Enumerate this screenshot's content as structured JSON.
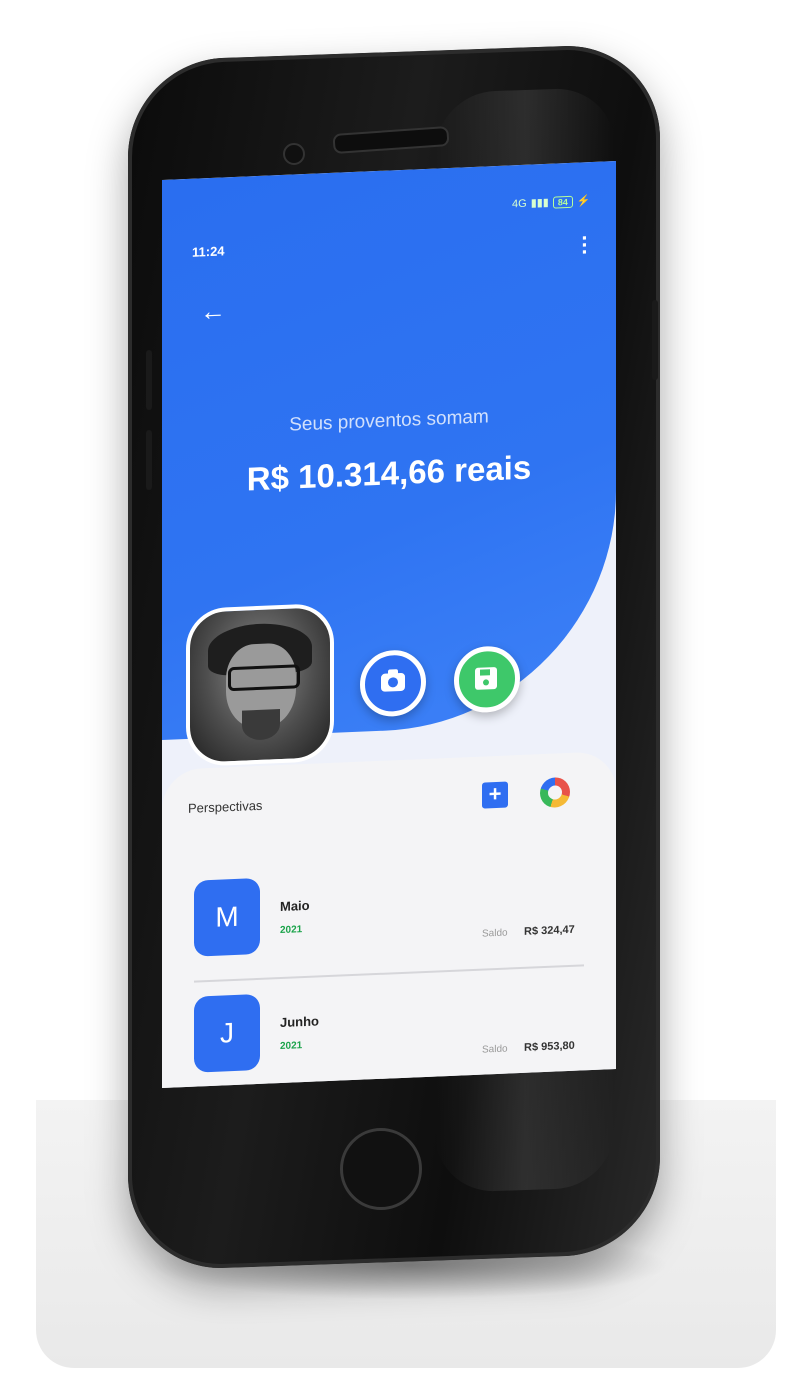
{
  "status_bar": {
    "time": "11:24",
    "network": "4G",
    "battery": "84"
  },
  "header": {
    "menu_icon": "more-vertical-icon",
    "back_icon": "arrow-left-icon"
  },
  "summary": {
    "caption": "Seus proventos somam",
    "amount": "R$ 10.314,66 reais"
  },
  "actions": {
    "camera_icon": "camera-icon",
    "save_icon": "floppy-disk-icon"
  },
  "perspectives": {
    "title": "Perspectivas",
    "add_label": "+",
    "chart_icon": "donut-chart-icon",
    "items": [
      {
        "initial": "M",
        "month": "Maio",
        "year": "2021",
        "saldo_label": "Saldo",
        "saldo_value": "R$ 324,47"
      },
      {
        "initial": "J",
        "month": "Junho",
        "year": "2021",
        "saldo_label": "Saldo",
        "saldo_value": "R$ 953,80"
      }
    ]
  },
  "colors": {
    "primary": "#2f6ef1",
    "success": "#3ec86a",
    "year_text": "#1aa34a",
    "panel_bg": "#f4f4f6"
  }
}
